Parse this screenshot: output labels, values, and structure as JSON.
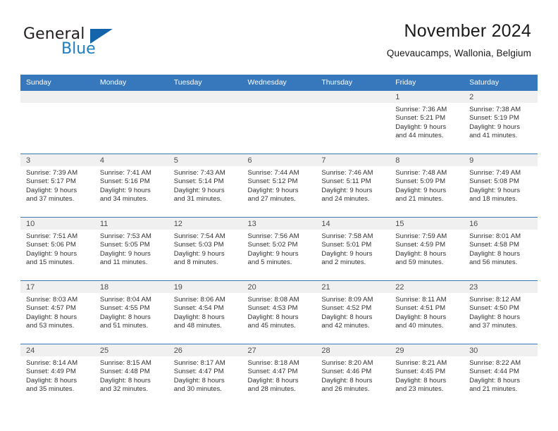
{
  "brand": {
    "name_part1": "General",
    "name_part2": "Blue",
    "triangle_color": "#1464ab",
    "blue_color": "#1f7ec2"
  },
  "header": {
    "title": "November 2024",
    "subtitle": "Quevaucamps, Wallonia, Belgium",
    "header_bg": "#3777bc",
    "daynum_bg": "#f0f0f0"
  },
  "weekdays": [
    "Sunday",
    "Monday",
    "Tuesday",
    "Wednesday",
    "Thursday",
    "Friday",
    "Saturday"
  ],
  "weeks": [
    [
      {
        "day": ""
      },
      {
        "day": ""
      },
      {
        "day": ""
      },
      {
        "day": ""
      },
      {
        "day": ""
      },
      {
        "day": "1",
        "sunrise": "Sunrise: 7:36 AM",
        "sunset": "Sunset: 5:21 PM",
        "daylight1": "Daylight: 9 hours",
        "daylight2": "and 44 minutes."
      },
      {
        "day": "2",
        "sunrise": "Sunrise: 7:38 AM",
        "sunset": "Sunset: 5:19 PM",
        "daylight1": "Daylight: 9 hours",
        "daylight2": "and 41 minutes."
      }
    ],
    [
      {
        "day": "3",
        "sunrise": "Sunrise: 7:39 AM",
        "sunset": "Sunset: 5:17 PM",
        "daylight1": "Daylight: 9 hours",
        "daylight2": "and 37 minutes."
      },
      {
        "day": "4",
        "sunrise": "Sunrise: 7:41 AM",
        "sunset": "Sunset: 5:16 PM",
        "daylight1": "Daylight: 9 hours",
        "daylight2": "and 34 minutes."
      },
      {
        "day": "5",
        "sunrise": "Sunrise: 7:43 AM",
        "sunset": "Sunset: 5:14 PM",
        "daylight1": "Daylight: 9 hours",
        "daylight2": "and 31 minutes."
      },
      {
        "day": "6",
        "sunrise": "Sunrise: 7:44 AM",
        "sunset": "Sunset: 5:12 PM",
        "daylight1": "Daylight: 9 hours",
        "daylight2": "and 27 minutes."
      },
      {
        "day": "7",
        "sunrise": "Sunrise: 7:46 AM",
        "sunset": "Sunset: 5:11 PM",
        "daylight1": "Daylight: 9 hours",
        "daylight2": "and 24 minutes."
      },
      {
        "day": "8",
        "sunrise": "Sunrise: 7:48 AM",
        "sunset": "Sunset: 5:09 PM",
        "daylight1": "Daylight: 9 hours",
        "daylight2": "and 21 minutes."
      },
      {
        "day": "9",
        "sunrise": "Sunrise: 7:49 AM",
        "sunset": "Sunset: 5:08 PM",
        "daylight1": "Daylight: 9 hours",
        "daylight2": "and 18 minutes."
      }
    ],
    [
      {
        "day": "10",
        "sunrise": "Sunrise: 7:51 AM",
        "sunset": "Sunset: 5:06 PM",
        "daylight1": "Daylight: 9 hours",
        "daylight2": "and 15 minutes."
      },
      {
        "day": "11",
        "sunrise": "Sunrise: 7:53 AM",
        "sunset": "Sunset: 5:05 PM",
        "daylight1": "Daylight: 9 hours",
        "daylight2": "and 11 minutes."
      },
      {
        "day": "12",
        "sunrise": "Sunrise: 7:54 AM",
        "sunset": "Sunset: 5:03 PM",
        "daylight1": "Daylight: 9 hours",
        "daylight2": "and 8 minutes."
      },
      {
        "day": "13",
        "sunrise": "Sunrise: 7:56 AM",
        "sunset": "Sunset: 5:02 PM",
        "daylight1": "Daylight: 9 hours",
        "daylight2": "and 5 minutes."
      },
      {
        "day": "14",
        "sunrise": "Sunrise: 7:58 AM",
        "sunset": "Sunset: 5:01 PM",
        "daylight1": "Daylight: 9 hours",
        "daylight2": "and 2 minutes."
      },
      {
        "day": "15",
        "sunrise": "Sunrise: 7:59 AM",
        "sunset": "Sunset: 4:59 PM",
        "daylight1": "Daylight: 8 hours",
        "daylight2": "and 59 minutes."
      },
      {
        "day": "16",
        "sunrise": "Sunrise: 8:01 AM",
        "sunset": "Sunset: 4:58 PM",
        "daylight1": "Daylight: 8 hours",
        "daylight2": "and 56 minutes."
      }
    ],
    [
      {
        "day": "17",
        "sunrise": "Sunrise: 8:03 AM",
        "sunset": "Sunset: 4:57 PM",
        "daylight1": "Daylight: 8 hours",
        "daylight2": "and 53 minutes."
      },
      {
        "day": "18",
        "sunrise": "Sunrise: 8:04 AM",
        "sunset": "Sunset: 4:55 PM",
        "daylight1": "Daylight: 8 hours",
        "daylight2": "and 51 minutes."
      },
      {
        "day": "19",
        "sunrise": "Sunrise: 8:06 AM",
        "sunset": "Sunset: 4:54 PM",
        "daylight1": "Daylight: 8 hours",
        "daylight2": "and 48 minutes."
      },
      {
        "day": "20",
        "sunrise": "Sunrise: 8:08 AM",
        "sunset": "Sunset: 4:53 PM",
        "daylight1": "Daylight: 8 hours",
        "daylight2": "and 45 minutes."
      },
      {
        "day": "21",
        "sunrise": "Sunrise: 8:09 AM",
        "sunset": "Sunset: 4:52 PM",
        "daylight1": "Daylight: 8 hours",
        "daylight2": "and 42 minutes."
      },
      {
        "day": "22",
        "sunrise": "Sunrise: 8:11 AM",
        "sunset": "Sunset: 4:51 PM",
        "daylight1": "Daylight: 8 hours",
        "daylight2": "and 40 minutes."
      },
      {
        "day": "23",
        "sunrise": "Sunrise: 8:12 AM",
        "sunset": "Sunset: 4:50 PM",
        "daylight1": "Daylight: 8 hours",
        "daylight2": "and 37 minutes."
      }
    ],
    [
      {
        "day": "24",
        "sunrise": "Sunrise: 8:14 AM",
        "sunset": "Sunset: 4:49 PM",
        "daylight1": "Daylight: 8 hours",
        "daylight2": "and 35 minutes."
      },
      {
        "day": "25",
        "sunrise": "Sunrise: 8:15 AM",
        "sunset": "Sunset: 4:48 PM",
        "daylight1": "Daylight: 8 hours",
        "daylight2": "and 32 minutes."
      },
      {
        "day": "26",
        "sunrise": "Sunrise: 8:17 AM",
        "sunset": "Sunset: 4:47 PM",
        "daylight1": "Daylight: 8 hours",
        "daylight2": "and 30 minutes."
      },
      {
        "day": "27",
        "sunrise": "Sunrise: 8:18 AM",
        "sunset": "Sunset: 4:47 PM",
        "daylight1": "Daylight: 8 hours",
        "daylight2": "and 28 minutes."
      },
      {
        "day": "28",
        "sunrise": "Sunrise: 8:20 AM",
        "sunset": "Sunset: 4:46 PM",
        "daylight1": "Daylight: 8 hours",
        "daylight2": "and 26 minutes."
      },
      {
        "day": "29",
        "sunrise": "Sunrise: 8:21 AM",
        "sunset": "Sunset: 4:45 PM",
        "daylight1": "Daylight: 8 hours",
        "daylight2": "and 23 minutes."
      },
      {
        "day": "30",
        "sunrise": "Sunrise: 8:22 AM",
        "sunset": "Sunset: 4:44 PM",
        "daylight1": "Daylight: 8 hours",
        "daylight2": "and 21 minutes."
      }
    ]
  ]
}
